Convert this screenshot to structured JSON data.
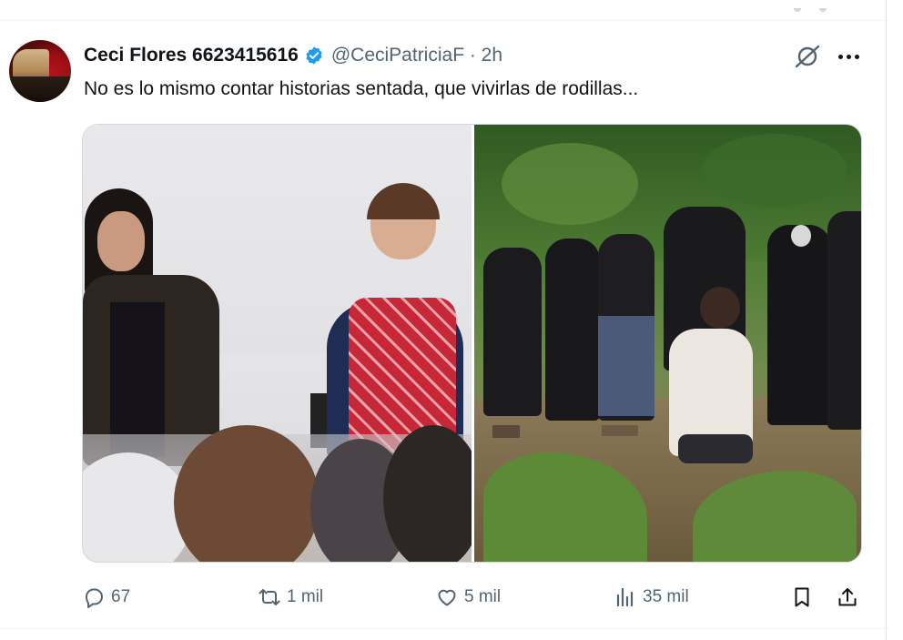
{
  "tweet": {
    "display_name": "Ceci Flores 6623415616",
    "handle_time": "@CeciPatriciaF · 2h",
    "text": "No es lo mismo contar historias sentada, que vivirlas de rodillas..."
  },
  "actions": {
    "replies": "67",
    "reposts": "1 mil",
    "likes": "5 mil",
    "views": "35 mil"
  },
  "icons": [
    "verified-badge-icon",
    "grok-icon",
    "more-icon",
    "reply-icon",
    "repost-icon",
    "like-icon",
    "views-icon",
    "bookmark-icon",
    "share-icon"
  ],
  "colors": {
    "text_primary": "#0f1419",
    "text_secondary": "#536471",
    "verified_blue": "#1d9bf0"
  }
}
